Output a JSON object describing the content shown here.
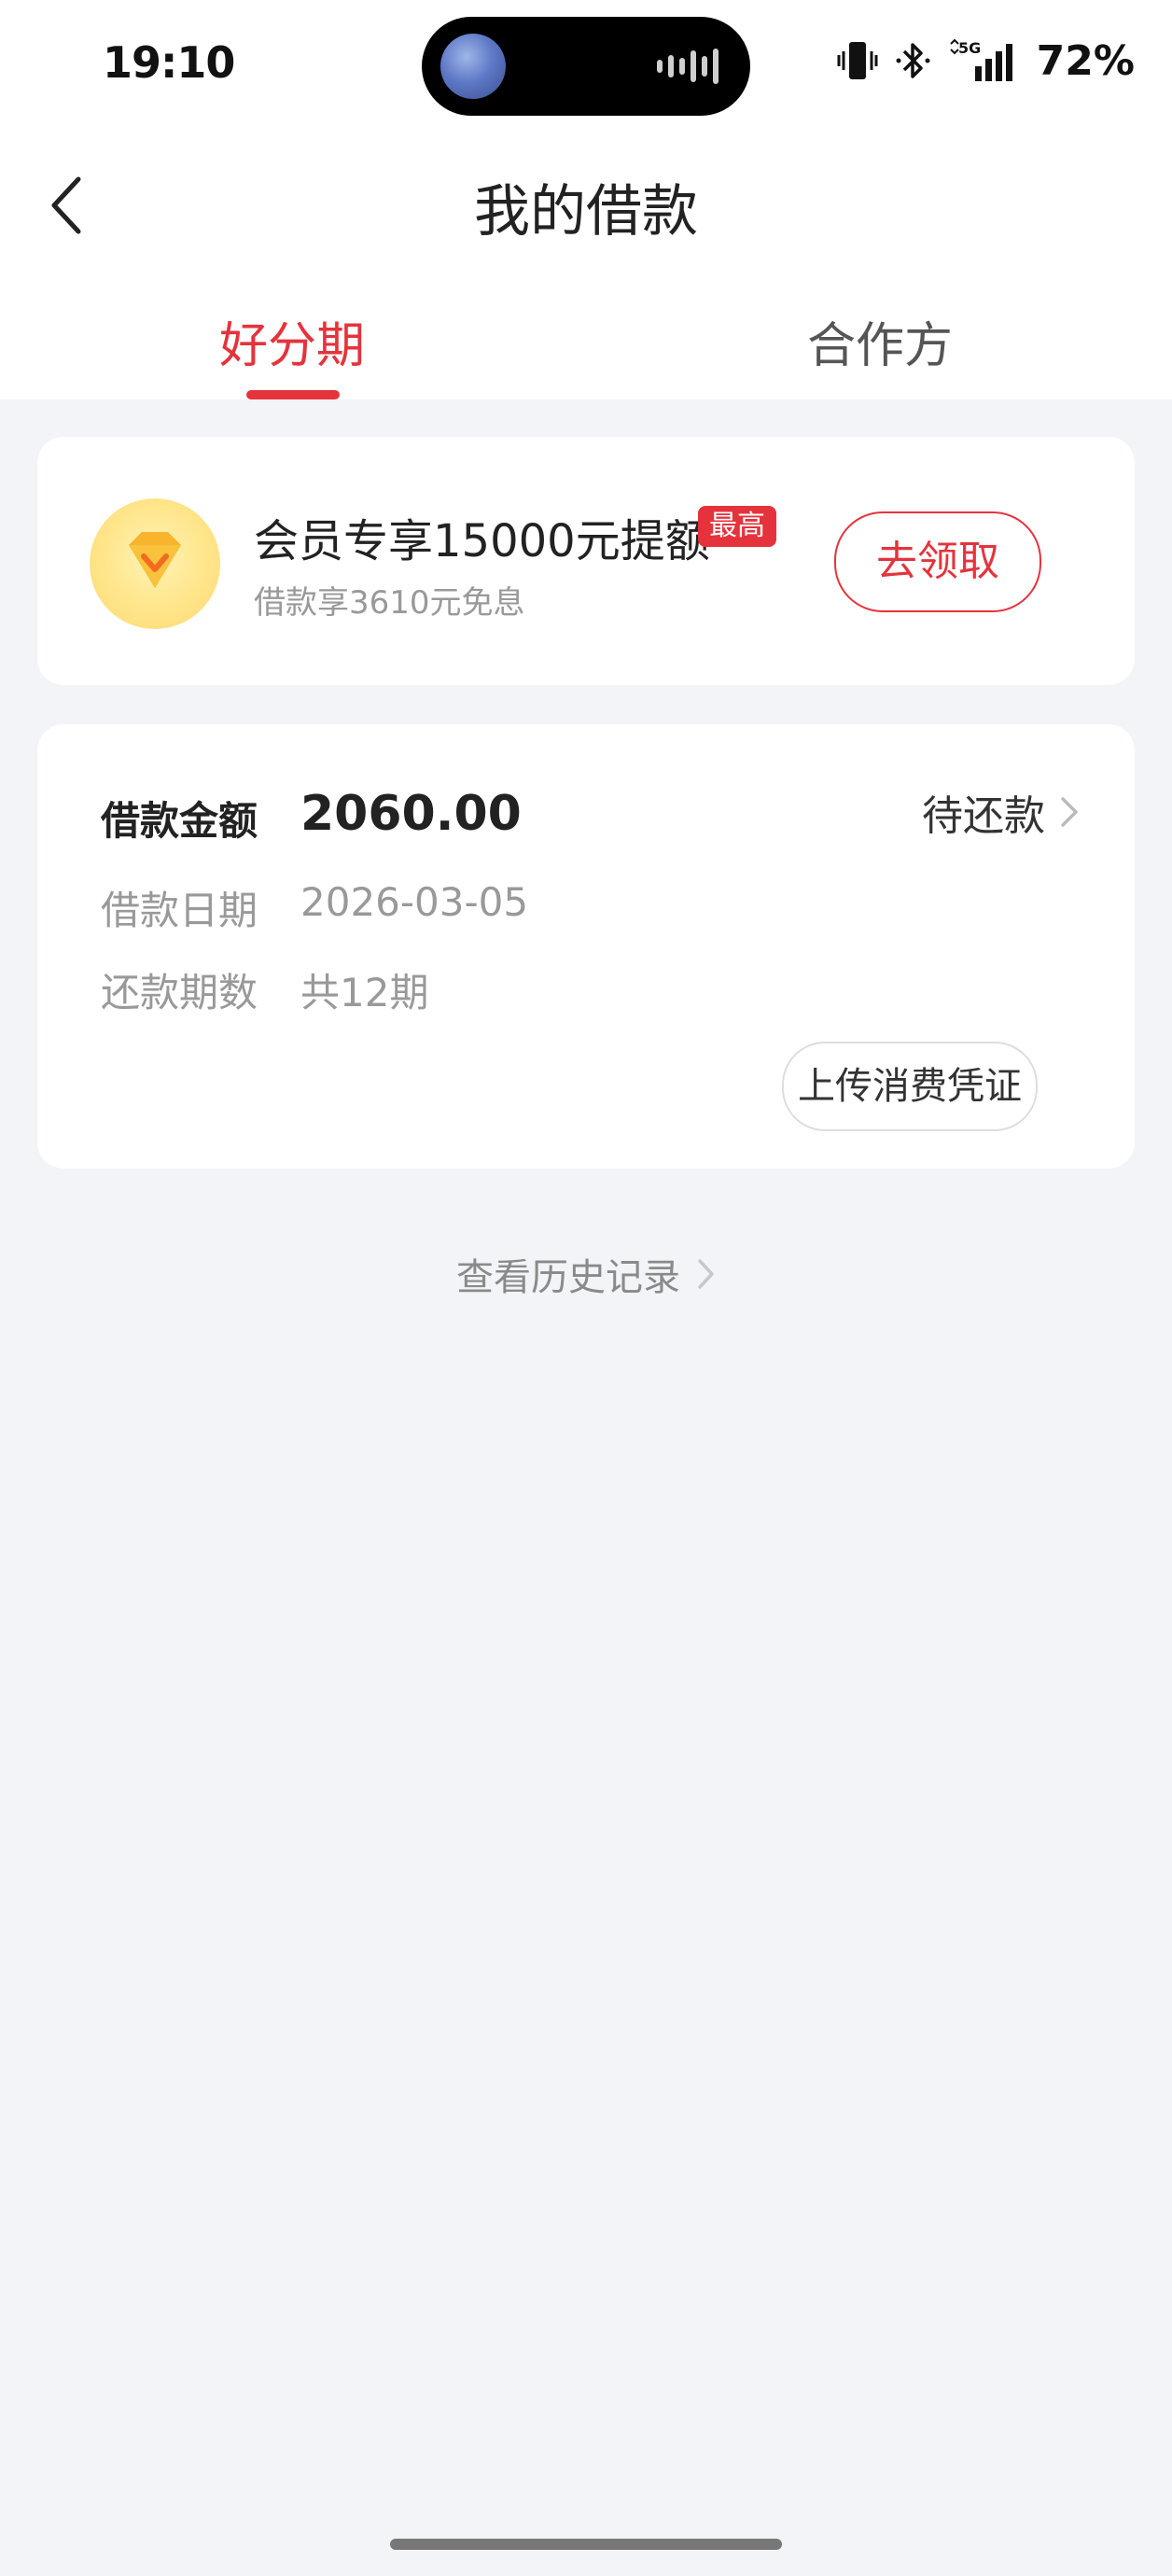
{
  "status_bar": {
    "time": "19:10",
    "battery": "72%",
    "network": "5G",
    "icons": [
      "vibrate-icon",
      "bluetooth-icon",
      "5g-signal-icon"
    ]
  },
  "nav": {
    "title": "我的借款",
    "back_icon": "chevron-left-icon"
  },
  "tabs": [
    {
      "label": "好分期",
      "active": true
    },
    {
      "label": "合作方",
      "active": false
    }
  ],
  "promo": {
    "icon": "diamond-badge-icon",
    "title": "会员专享15000元提额",
    "tag": "最高",
    "subtitle": "借款享3610元免息",
    "button": "去领取"
  },
  "loan": {
    "amount_label": "借款金额",
    "amount": "2060.00",
    "status": "待还款",
    "date_label": "借款日期",
    "date": "2026-03-05",
    "periods_label": "还款期数",
    "periods": "共12期",
    "upload_button": "上传消费凭证"
  },
  "history_link": "查看历史记录",
  "colors": {
    "accent": "#e5333c",
    "background": "#f3f4f8",
    "card": "#ffffff",
    "muted_text": "#999999"
  }
}
